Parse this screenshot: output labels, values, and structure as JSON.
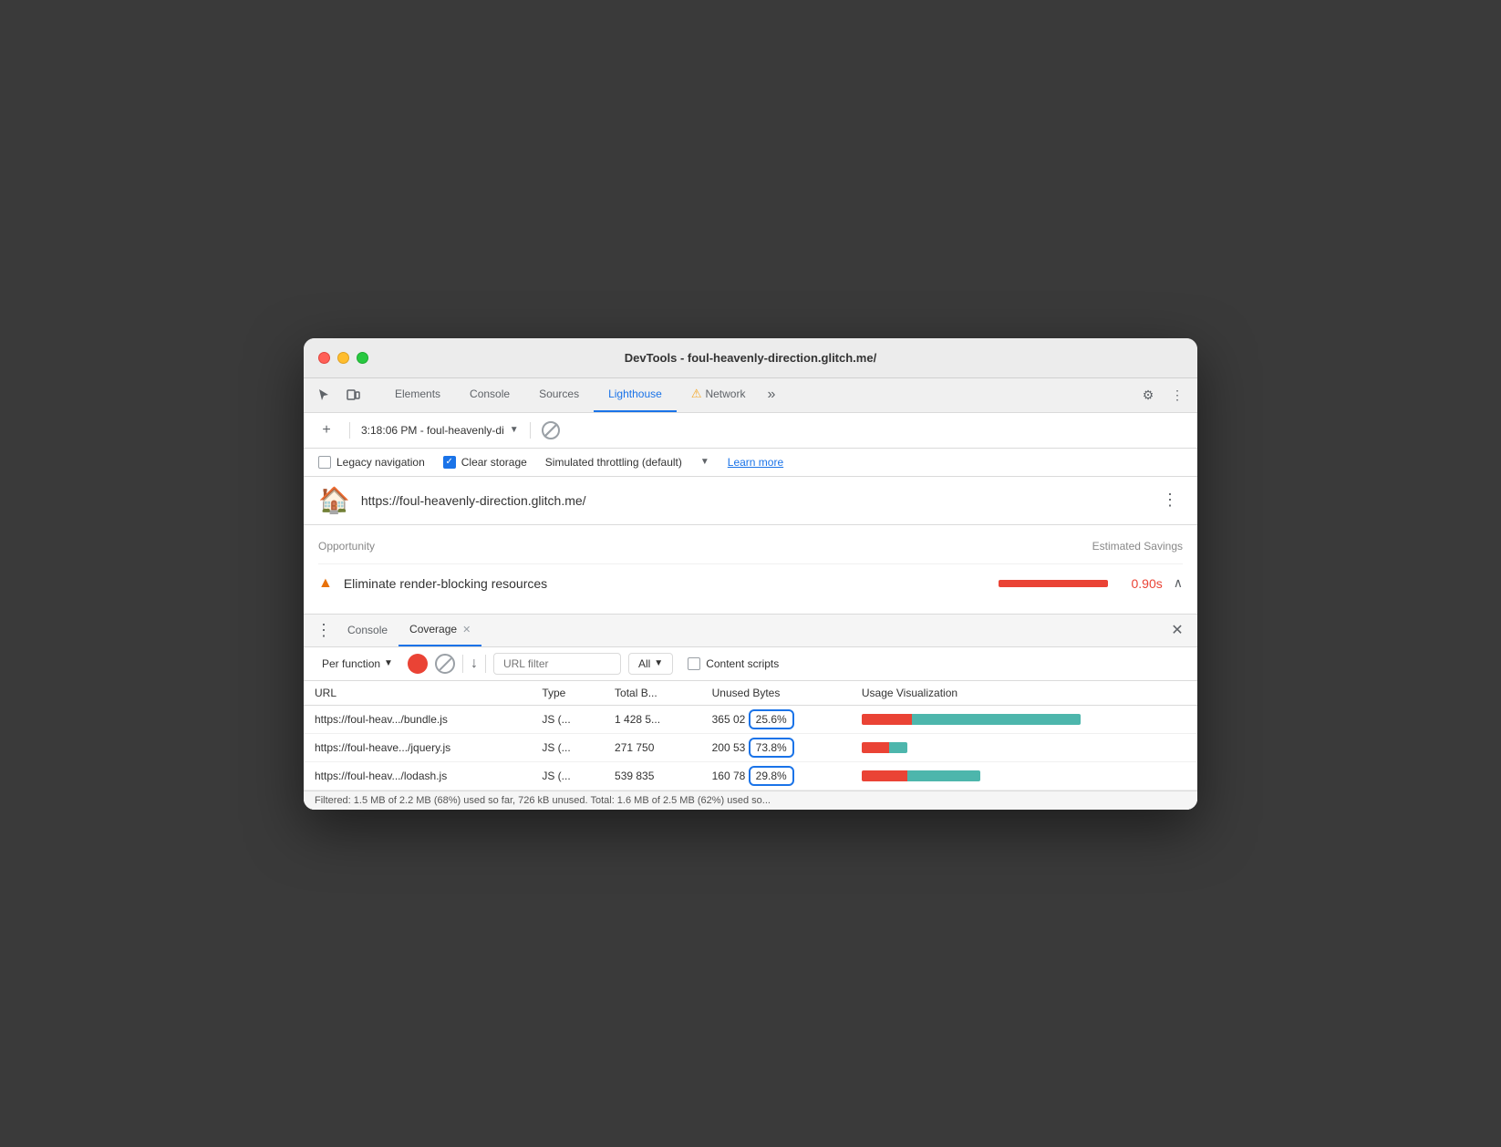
{
  "window": {
    "title": "DevTools - foul-heavenly-direction.glitch.me/"
  },
  "tabs": [
    {
      "label": "Elements",
      "active": false
    },
    {
      "label": "Console",
      "active": false
    },
    {
      "label": "Sources",
      "active": false
    },
    {
      "label": "Lighthouse",
      "active": true
    },
    {
      "label": "Network",
      "active": false,
      "warning": true
    }
  ],
  "toolbar": {
    "time_url": "3:18:06 PM - foul-heavenly-di",
    "more_label": "»"
  },
  "options": {
    "legacy_nav": {
      "label": "Legacy navigation",
      "checked": false
    },
    "clear_storage": {
      "label": "Clear storage",
      "checked": true
    },
    "throttling": {
      "label": "Simulated throttling (default)"
    },
    "learn_more": "Learn more"
  },
  "lighthouse": {
    "url": "https://foul-heavenly-direction.glitch.me/",
    "opportunity_label": "Opportunity",
    "savings_label": "Estimated Savings",
    "item": {
      "title": "Eliminate render-blocking resources",
      "savings": "0.90s"
    }
  },
  "bottom_panel": {
    "tabs": [
      {
        "label": "Console",
        "active": false
      },
      {
        "label": "Coverage",
        "active": true,
        "closeable": true
      }
    ]
  },
  "coverage": {
    "per_function": "Per function",
    "url_filter_placeholder": "URL filter",
    "all_label": "All",
    "content_scripts": "Content scripts",
    "columns": {
      "url": "URL",
      "type": "Type",
      "total_bytes": "Total B...",
      "unused_bytes": "Unused Bytes",
      "usage_viz": "Usage Visualization"
    },
    "rows": [
      {
        "url": "https://foul-heav.../bundle.js",
        "type": "JS (...",
        "total_bytes": "1 428 5...",
        "unused_bytes": "365 02",
        "unused_pct": "25.6%",
        "used_ratio": 74,
        "unused_ratio": 26,
        "bar_used_width": 55,
        "bar_unused_width": 185
      },
      {
        "url": "https://foul-heave.../jquery.js",
        "type": "JS (...",
        "total_bytes": "271 750",
        "unused_bytes": "200 53",
        "unused_pct": "73.8%",
        "used_ratio": 26,
        "unused_ratio": 74,
        "bar_used_width": 30,
        "bar_unused_width": 20
      },
      {
        "url": "https://foul-heav.../lodash.js",
        "type": "JS (...",
        "total_bytes": "539 835",
        "unused_bytes": "160 78",
        "unused_pct": "29.8%",
        "used_ratio": 70,
        "unused_ratio": 30,
        "bar_used_width": 50,
        "bar_unused_width": 80
      }
    ],
    "status_bar": "Filtered: 1.5 MB of 2.2 MB (68%) used so far, 726 kB unused. Total: 1.6 MB of 2.5 MB (62%) used so..."
  }
}
